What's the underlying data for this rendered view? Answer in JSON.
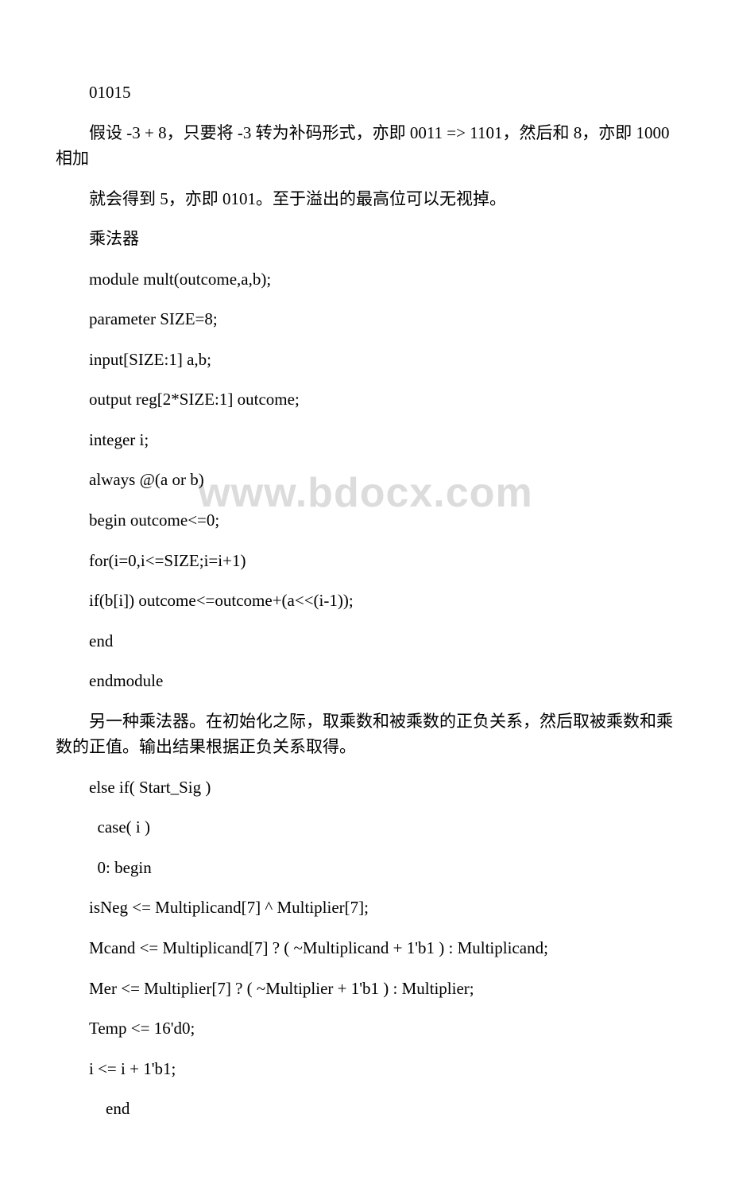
{
  "watermark": "www.bdocx.com",
  "paragraphs": [
    {
      "text": " 01015",
      "cls": "code0"
    },
    {
      "text": "假设 -3 + 8，只要将 -3 转为补码形式，亦即 0011 => 1101，然后和 8，亦即 1000 相加",
      "cls": ""
    },
    {
      "text": "就会得到 5，亦即 0101。至于溢出的最高位可以无视掉。",
      "cls": ""
    },
    {
      "text": "乘法器",
      "cls": ""
    },
    {
      "text": "module mult(outcome,a,b);",
      "cls": "code0"
    },
    {
      "text": "parameter SIZE=8;",
      "cls": "code0"
    },
    {
      "text": "input[SIZE:1] a,b;",
      "cls": "code0"
    },
    {
      "text": "output reg[2*SIZE:1] outcome;",
      "cls": "code0"
    },
    {
      "text": "integer i;",
      "cls": "code0"
    },
    {
      "text": "always @(a or b)",
      "cls": "code0"
    },
    {
      "text": " begin outcome<=0;",
      "cls": "code0"
    },
    {
      "text": " for(i=0,i<=SIZE;i=i+1)",
      "cls": "code0"
    },
    {
      "text": " if(b[i]) outcome<=outcome+(a<<(i-1));",
      "cls": "code0"
    },
    {
      "text": " end",
      "cls": "code0"
    },
    {
      "text": "endmodule",
      "cls": "code0"
    },
    {
      "text": "另一种乘法器。在初始化之际，取乘数和被乘数的正负关系，然后取被乘数和乘数的正值。输出结果根据正负关系取得。",
      "cls": ""
    },
    {
      "text": "else if( Start_Sig )",
      "cls": "code0"
    },
    {
      "text": " case( i )",
      "cls": "code1"
    },
    {
      "text": " 0: begin",
      "cls": "code1"
    },
    {
      "text": " isNeg <= Multiplicand[7] ^ Multiplier[7];",
      "cls": "code0"
    },
    {
      "text": " Mcand <= Multiplicand[7] ? ( ~Multiplicand + 1'b1 ) : Multiplicand;",
      "cls": "code0"
    },
    {
      "text": " Mer <= Multiplier[7] ? ( ~Multiplier + 1'b1 ) : Multiplier;",
      "cls": "code0"
    },
    {
      "text": " Temp <= 16'd0;",
      "cls": "code0"
    },
    {
      "text": " i <= i + 1'b1;",
      "cls": "code0"
    },
    {
      "text": "  end",
      "cls": "code2"
    }
  ]
}
